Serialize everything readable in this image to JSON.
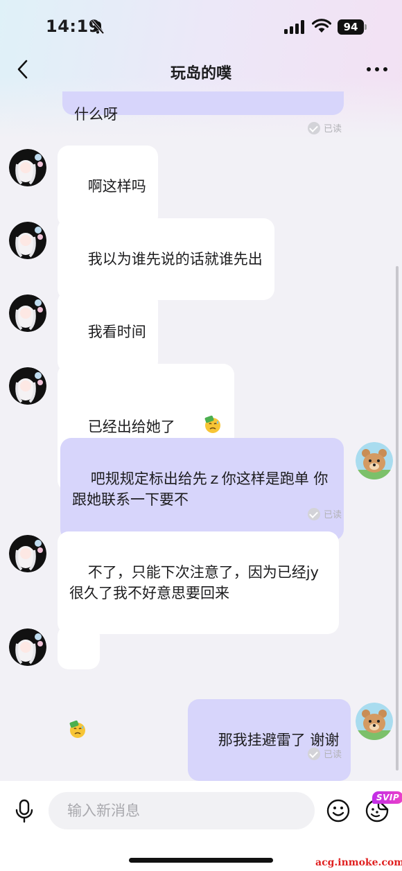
{
  "status_bar": {
    "time": "14:19",
    "battery": "94"
  },
  "nav": {
    "title": "玩岛的噗"
  },
  "messages": {
    "m0": {
      "text": "什么呀",
      "read": "已读"
    },
    "m1": {
      "text": "啊这样吗"
    },
    "m2": {
      "text": "我以为谁先说的话就谁先出"
    },
    "m3": {
      "text": "我看时间"
    },
    "m4": {
      "text": "已经出给她了",
      "emoji": "sweat-money-emoji"
    },
    "m5": {
      "text": "吧规规定标出给先ｚ你这样是跑单 你\n跟她联系一下要不",
      "read": "已读"
    },
    "m6": {
      "text": "不了，只能下次注意了，因为已经jy\n很久了我不好意思要回来"
    },
    "m7": {
      "emoji": "sweat-money-emoji"
    },
    "m8": {
      "text": "那我挂避雷了 谢谢",
      "read": "已读"
    }
  },
  "input": {
    "placeholder": "输入新消息"
  },
  "badges": {
    "svip": "SVIP"
  },
  "watermark": "acg.inmoke.com",
  "colors": {
    "outgoing_bubble": "#d7d5fb",
    "incoming_bubble": "#ffffff",
    "background": "#f2f1f6",
    "svip": "#c02ce8"
  }
}
